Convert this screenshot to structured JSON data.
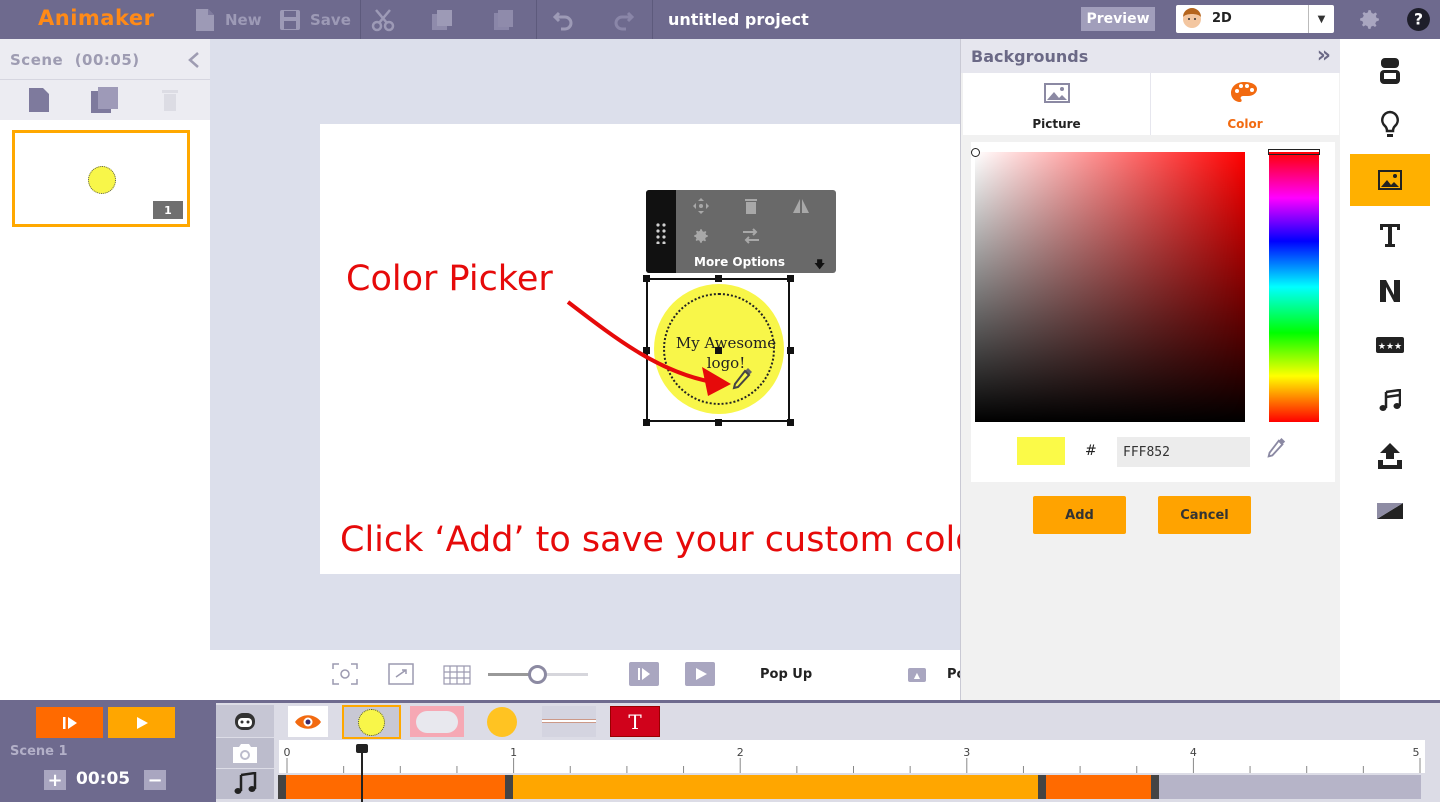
{
  "app": {
    "name": "Animaker"
  },
  "toolbar": {
    "new_label": "New",
    "save_label": "Save",
    "project_title": "untitled project",
    "preview_label": "Preview",
    "mode_value": "2D"
  },
  "scene_panel": {
    "title": "Scene",
    "duration": "(00:05)",
    "thumbnail_number": "1"
  },
  "stage": {
    "logo_text_line1": "My Awesome",
    "logo_text_line2": "logo!",
    "more_options_label": "More Options",
    "annotation_picker": "Color Picker",
    "annotation_add": "Click ‘Add’ to save your custom color"
  },
  "stage_controls": {
    "animation_label": "Pop Up",
    "animation_label_2": "Po"
  },
  "backgrounds_panel": {
    "title": "Backgrounds",
    "tabs": [
      {
        "label": "Picture",
        "active": false
      },
      {
        "label": "Color",
        "active": true
      }
    ],
    "hash_symbol": "#",
    "hex_value": "FFF852",
    "swatch_color": "#FBFA48",
    "add_label": "Add",
    "cancel_label": "Cancel"
  },
  "right_nav": {
    "items": [
      "character-icon",
      "idea-icon",
      "image-icon",
      "text-icon",
      "number-icon",
      "stars-icon",
      "music-icon",
      "upload-icon",
      "transition-icon"
    ],
    "active": "image-icon"
  },
  "timeline": {
    "scene_label": "Scene  1",
    "time": "00:05",
    "plus_label": "+",
    "minus_label": "−",
    "ticks": [
      "0",
      "1",
      "2",
      "3",
      "4",
      "5"
    ]
  },
  "colors": {
    "brand_orange": "#FF8A17",
    "accent_orange": "#FFA300",
    "topbar": "#6E6A8E",
    "annotation_red": "#E60A0A"
  }
}
